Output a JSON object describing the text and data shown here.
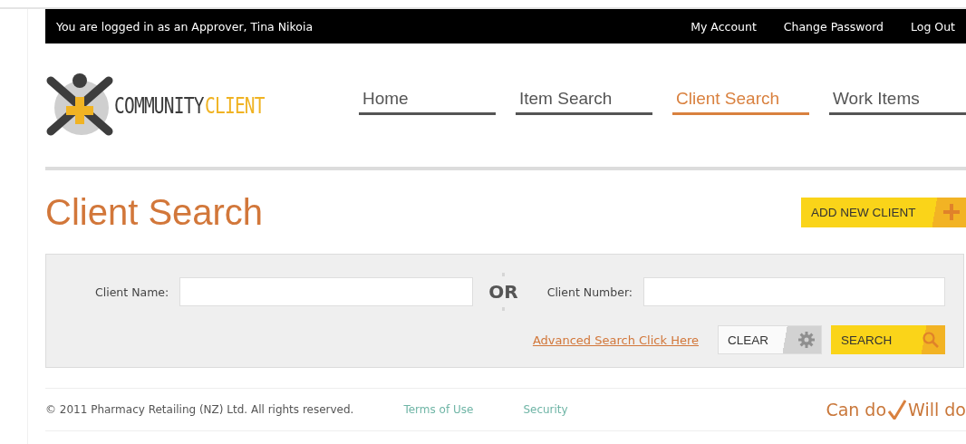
{
  "top_bar": {
    "login_text": "You are logged in as an Approver, Tina Nikoia",
    "links": [
      "My Account",
      "Change Password",
      "Log Out"
    ]
  },
  "logo": {
    "text_dark": "COMMUNITY",
    "text_light": "CLIENT"
  },
  "nav": [
    {
      "label": "Home",
      "selected": false
    },
    {
      "label": "Item Search",
      "selected": false
    },
    {
      "label": "Client Search",
      "selected": true
    },
    {
      "label": "Work Items",
      "selected": false
    }
  ],
  "page_title": "Client Search",
  "add_button": {
    "label": "ADD NEW CLIENT"
  },
  "search_form": {
    "client_name_label": "Client Name:",
    "or_label": "OR",
    "client_number_label": "Client Number:",
    "advanced_link": "Advanced Search Click Here",
    "clear_button": "CLEAR",
    "search_button": "SEARCH"
  },
  "footer": {
    "copyright": "© 2011 Pharmacy Retailing (NZ) Ltd. All rights reserved.",
    "links": [
      "Terms of Use",
      "Security"
    ],
    "slogan_left": "Can do",
    "slogan_right": "Will do"
  }
}
